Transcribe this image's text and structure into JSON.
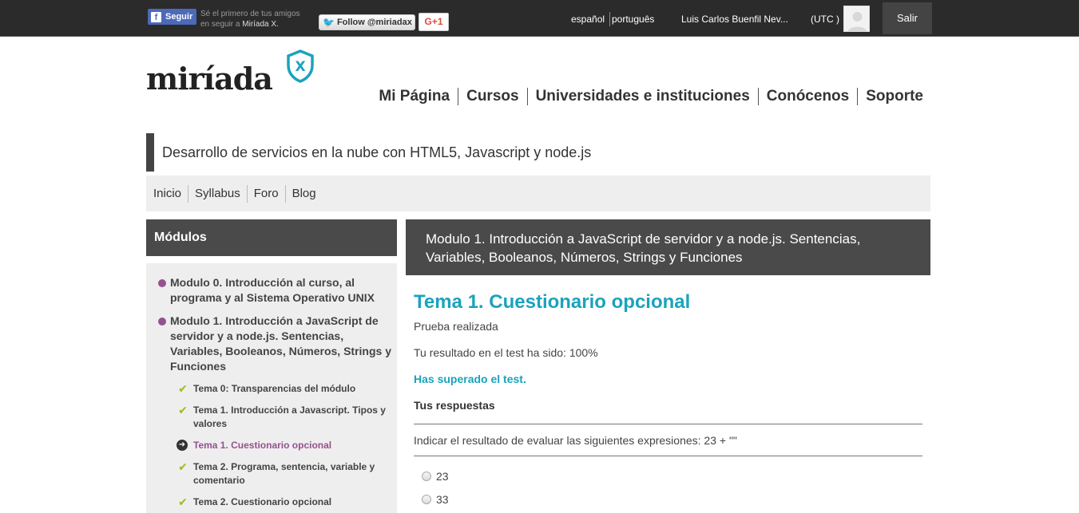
{
  "topbar": {
    "facebook_button": "Seguir",
    "facebook_text_line1": "Sé el primero de tus amigos",
    "facebook_text_line2": "en seguir a",
    "facebook_text_brand": "Miríada X.",
    "twitter_button": "Follow @miriadax",
    "gplus_button": "G+1",
    "lang_es": "español",
    "lang_pt": "português",
    "user_name": "Luis Carlos Buenfil Nev...",
    "timezone": "(UTC )",
    "logout": "Salir"
  },
  "logo": {
    "text": "miríada",
    "badge": "X"
  },
  "mainnav": [
    "Mi Página",
    "Cursos",
    "Universidades e instituciones",
    "Conócenos",
    "Soporte"
  ],
  "course": {
    "title": "Desarrollo de servicios en la nube con HTML5, Javascript y node.js"
  },
  "coursenav": [
    "Inicio",
    "Syllabus",
    "Foro",
    "Blog"
  ],
  "sidebar": {
    "heading": "Módulos",
    "modules": [
      {
        "label": "Modulo 0. Introducción al curso, al programa y al Sistema Operativo UNIX"
      },
      {
        "label": "Modulo 1. Introducción a JavaScript de servidor y a node.js. Sentencias, Variables, Booleanos, Números, Strings y Funciones"
      }
    ],
    "temas": [
      {
        "label": "Tema 0: Transparencias del módulo",
        "status": "done"
      },
      {
        "label": "Tema 1. Introducción a Javascript. Tipos y valores",
        "status": "done"
      },
      {
        "label": "Tema 1. Cuestionario opcional",
        "status": "current"
      },
      {
        "label": "Tema 2. Programa, sentencia, variable y comentario",
        "status": "done"
      },
      {
        "label": "Tema 2. Cuestionario opcional",
        "status": "done"
      }
    ]
  },
  "content": {
    "module_heading": "Modulo 1. Introducción a JavaScript de servidor y a node.js. Sentencias, Variables, Booleanos, Números, Strings y Funciones",
    "tema_title": "Tema 1. Cuestionario opcional",
    "status": "Prueba realizada",
    "result": "Tu resultado en el test ha sido: 100%",
    "passed": "Has superado el test.",
    "answers_heading": "Tus respuestas",
    "question": "Indicar el resultado de evaluar las siguientes expresiones: 23 + \"\"",
    "options": [
      "23",
      "33"
    ]
  },
  "colors": {
    "accent": "#1aa3bc",
    "purple": "#95518e",
    "check": "#9dbb1e",
    "dark": "#2b2b2b"
  }
}
